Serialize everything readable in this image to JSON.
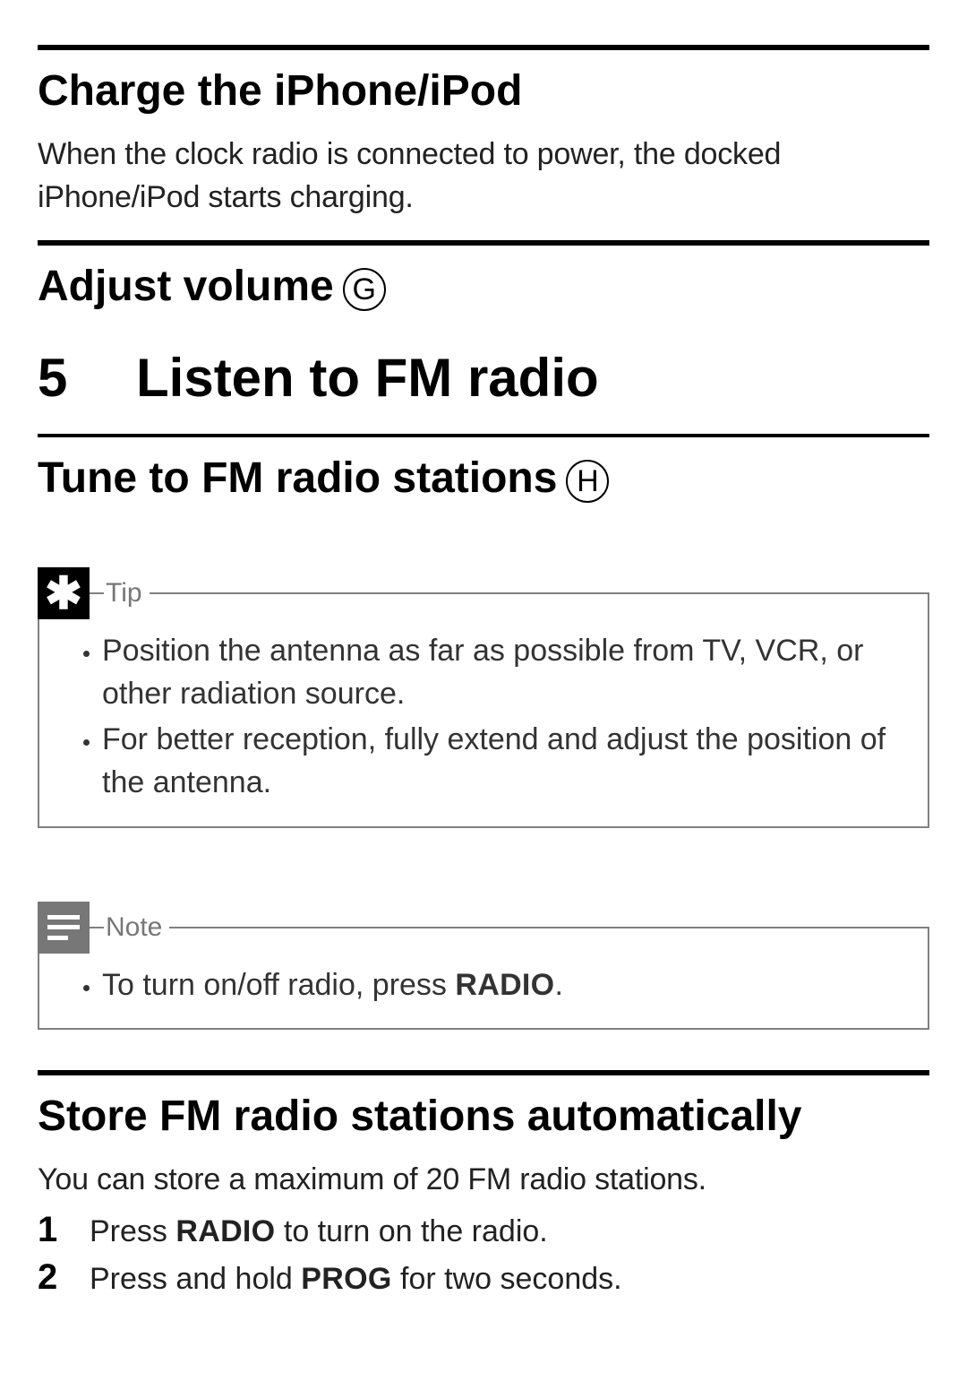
{
  "section_charge": {
    "title": "Charge the iPhone/iPod",
    "body": "When the clock radio is connected to power, the docked iPhone/iPod starts charging."
  },
  "section_volume": {
    "title": "Adjust volume",
    "ref_letter": "G"
  },
  "chapter": {
    "number": "5",
    "title": "Listen to FM radio"
  },
  "section_tune": {
    "title": "Tune to FM radio stations",
    "ref_letter": "H"
  },
  "tip": {
    "label": "Tip",
    "items": [
      "Position the antenna as far as possible from TV, VCR, or other radiation source.",
      "For better reception, fully extend and adjust the position of the antenna."
    ]
  },
  "note": {
    "label": "Note",
    "item_prefix": "To turn on/off radio, press ",
    "item_kb": "RADIO",
    "item_suffix": "."
  },
  "section_store": {
    "title": "Store FM radio stations automatically",
    "intro": "You can store a maximum of 20 FM radio stations.",
    "steps": [
      {
        "n": "1",
        "pre": "Press ",
        "kb": "RADIO",
        "post": " to turn on the radio."
      },
      {
        "n": "2",
        "pre": "Press and hold ",
        "kb": "PROG",
        "post": " for two seconds."
      }
    ]
  }
}
